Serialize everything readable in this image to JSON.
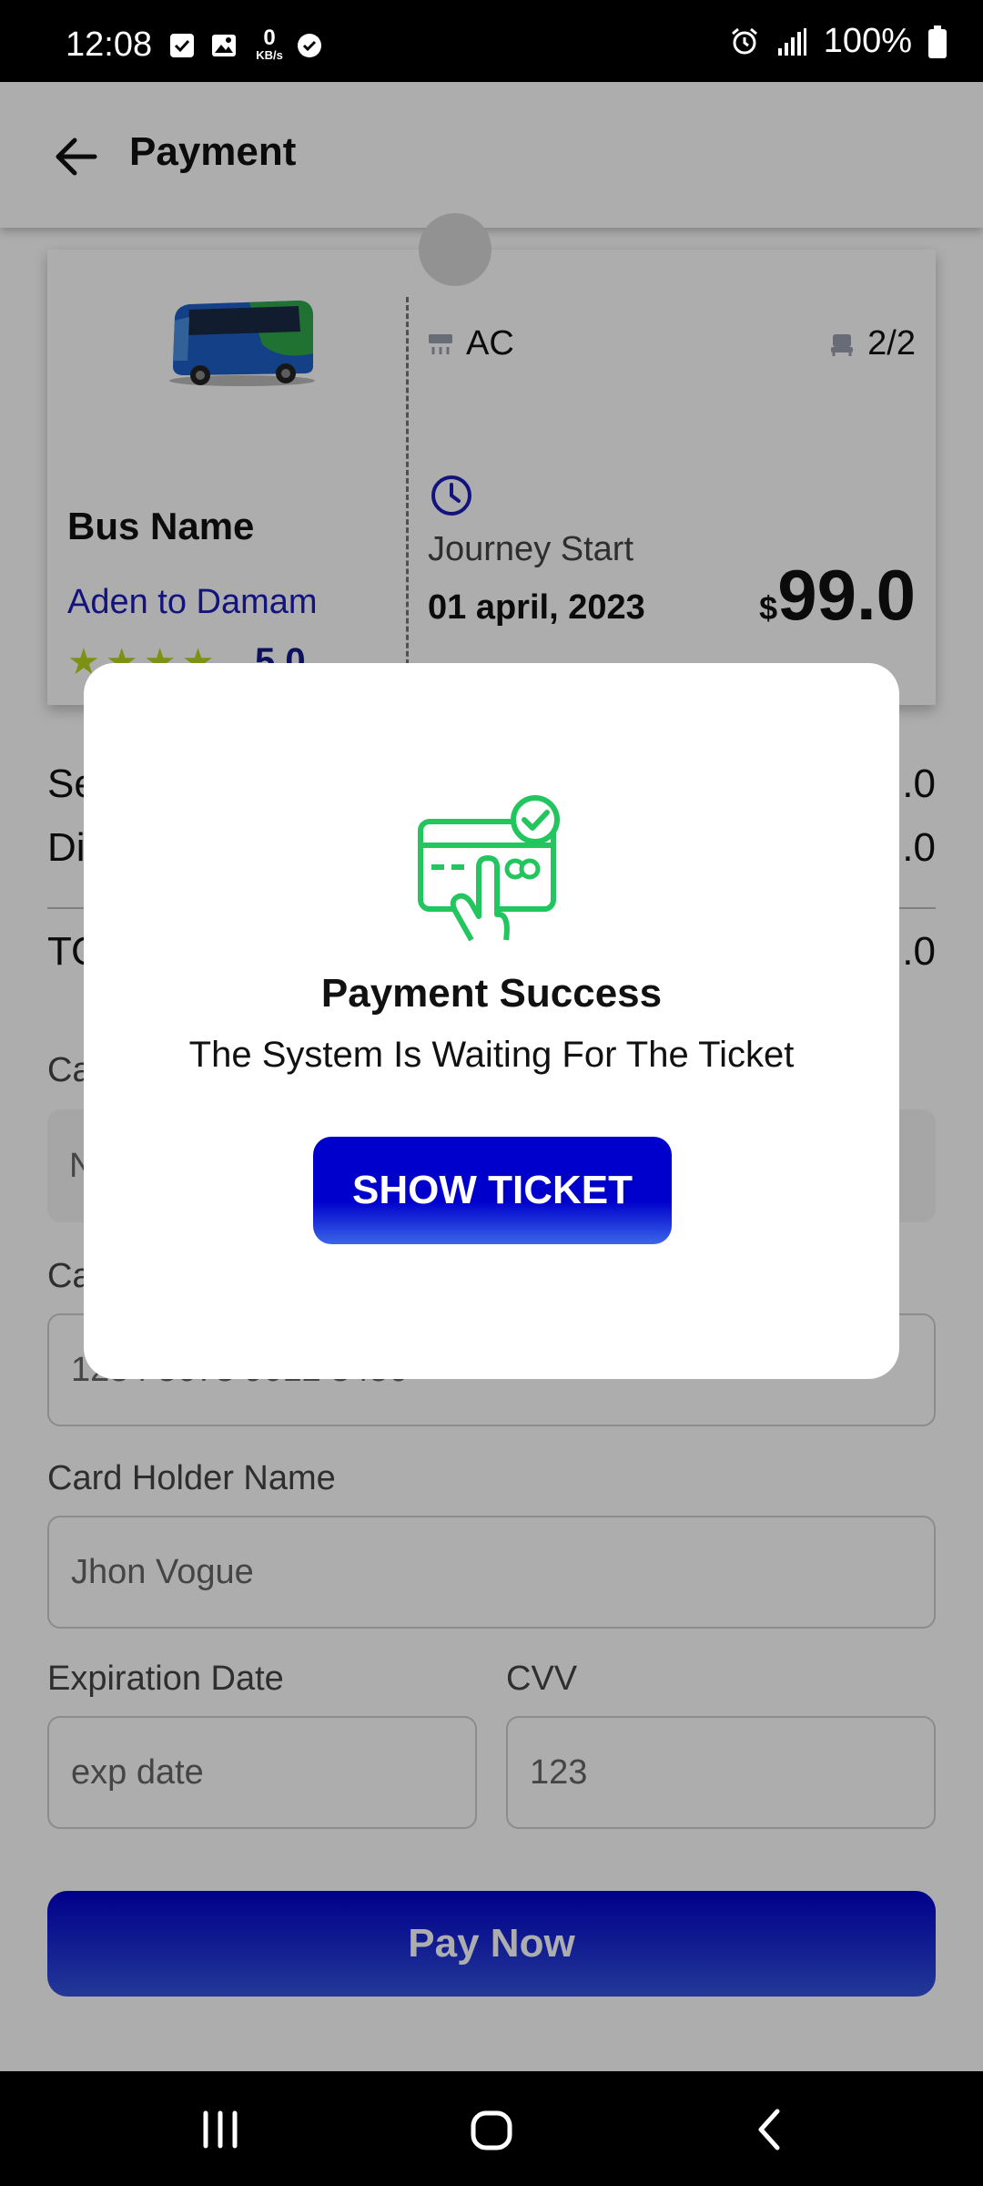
{
  "status_bar": {
    "time": "12:08",
    "net_speed_value": "0",
    "net_speed_unit": "KB/s",
    "battery": "100%"
  },
  "app_bar": {
    "title": "Payment"
  },
  "ticket": {
    "bus_name": "Bus Name",
    "route": "Aden to Damam",
    "stars": "★★★★",
    "rating": "5.0",
    "ac_label": "AC",
    "seats": "2/2",
    "journey_label": "Journey Start",
    "journey_date": "01 april, 2023",
    "currency": "$",
    "price": "99.0"
  },
  "summary": {
    "row1_label": "Se",
    "row1_value": ".0",
    "row2_label": "Di",
    "row2_value": ".0",
    "total_label": "TO",
    "total_value": ".0"
  },
  "form": {
    "card_name_label": "Ca",
    "card_name_value": "N",
    "card_number_label": "Ca",
    "card_number_value": "1234 5678 9012 3456",
    "holder_label": "Card Holder Name",
    "holder_value": "Jhon Vogue",
    "exp_label": "Expiration Date",
    "exp_placeholder": "exp date",
    "cvv_label": "CVV",
    "cvv_placeholder": "123",
    "pay_button": "Pay Now"
  },
  "dialog": {
    "title": "Payment Success",
    "message": "The System Is Waiting For The Ticket",
    "button": "SHOW TICKET"
  },
  "colors": {
    "primary": "#0000cc",
    "route_text": "#1d1db8",
    "success_green": "#22c55e",
    "star": "#b8d81e"
  }
}
